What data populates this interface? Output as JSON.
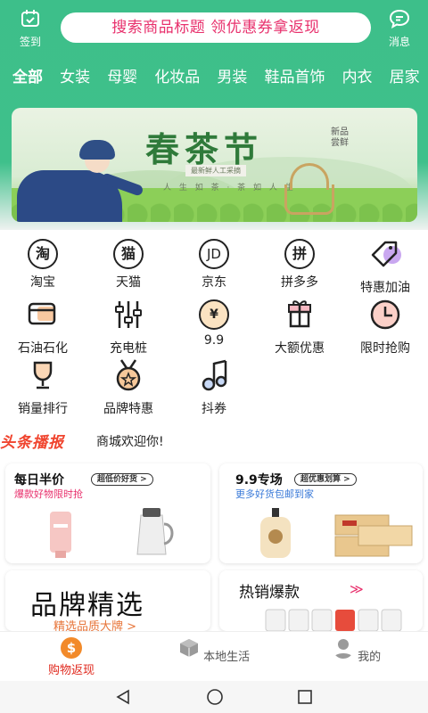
{
  "header": {
    "checkin_label": "签到",
    "search_text": "搜索商品标题 领优惠券拿返现",
    "message_label": "消息"
  },
  "tabs": [
    "全部",
    "女装",
    "母婴",
    "化妆品",
    "男装",
    "鞋品首饰",
    "内衣",
    "居家"
  ],
  "banner": {
    "title": "春茶节",
    "tag": "新品尝鲜",
    "sub": "最新鲜人工采摘",
    "line": "人 生 如 茶 · 茶 如 人 生"
  },
  "grid": [
    {
      "label": "淘宝",
      "icon": "taobao-icon",
      "glyph": "淘"
    },
    {
      "label": "天猫",
      "icon": "tmall-icon",
      "glyph": "猫"
    },
    {
      "label": "京东",
      "icon": "jd-icon",
      "glyph": "JD"
    },
    {
      "label": "拼多多",
      "icon": "pinduoduo-icon",
      "glyph": "拼"
    },
    {
      "label": "特惠加油",
      "icon": "tag-icon",
      "glyph": ""
    },
    {
      "label": "石油石化",
      "icon": "card-icon",
      "glyph": ""
    },
    {
      "label": "充电桩",
      "icon": "sliders-icon",
      "glyph": ""
    },
    {
      "label": "9.9",
      "icon": "yen-coin-icon",
      "glyph": "¥"
    },
    {
      "label": "大额优惠",
      "icon": "gift-icon",
      "glyph": ""
    },
    {
      "label": "限时抢购",
      "icon": "clock-icon",
      "glyph": ""
    },
    {
      "label": "销量排行",
      "icon": "trophy-icon",
      "glyph": ""
    },
    {
      "label": "品牌特惠",
      "icon": "medal-icon",
      "glyph": ""
    },
    {
      "label": "抖券",
      "icon": "music-note-icon",
      "glyph": ""
    }
  ],
  "headline": {
    "logo": "头条播报",
    "text": "商城欢迎你!"
  },
  "cards": {
    "half": {
      "title": "每日半价",
      "pill": "超低价好货 >",
      "sub": "爆款好物限时抢"
    },
    "nine": {
      "title": "9.9专场",
      "pill": "超优惠划算 >",
      "sub": "更多好货包邮到家"
    },
    "brand": {
      "title": "品牌精选",
      "sub": "精选品质大牌 >"
    },
    "hot": {
      "title": "热销爆款",
      "arrow": "≫"
    }
  },
  "nav": [
    {
      "label": "购物返现",
      "icon": "dollar-coin-icon",
      "active": true
    },
    {
      "label": "本地生活",
      "icon": "cube-icon",
      "active": false
    },
    {
      "label": "我的",
      "icon": "person-icon",
      "active": false
    }
  ],
  "colors": {
    "primary": "#3dbf8a",
    "accent": "#e8316d",
    "nav_active": "#e02a1f",
    "headline": "#f0452f"
  }
}
